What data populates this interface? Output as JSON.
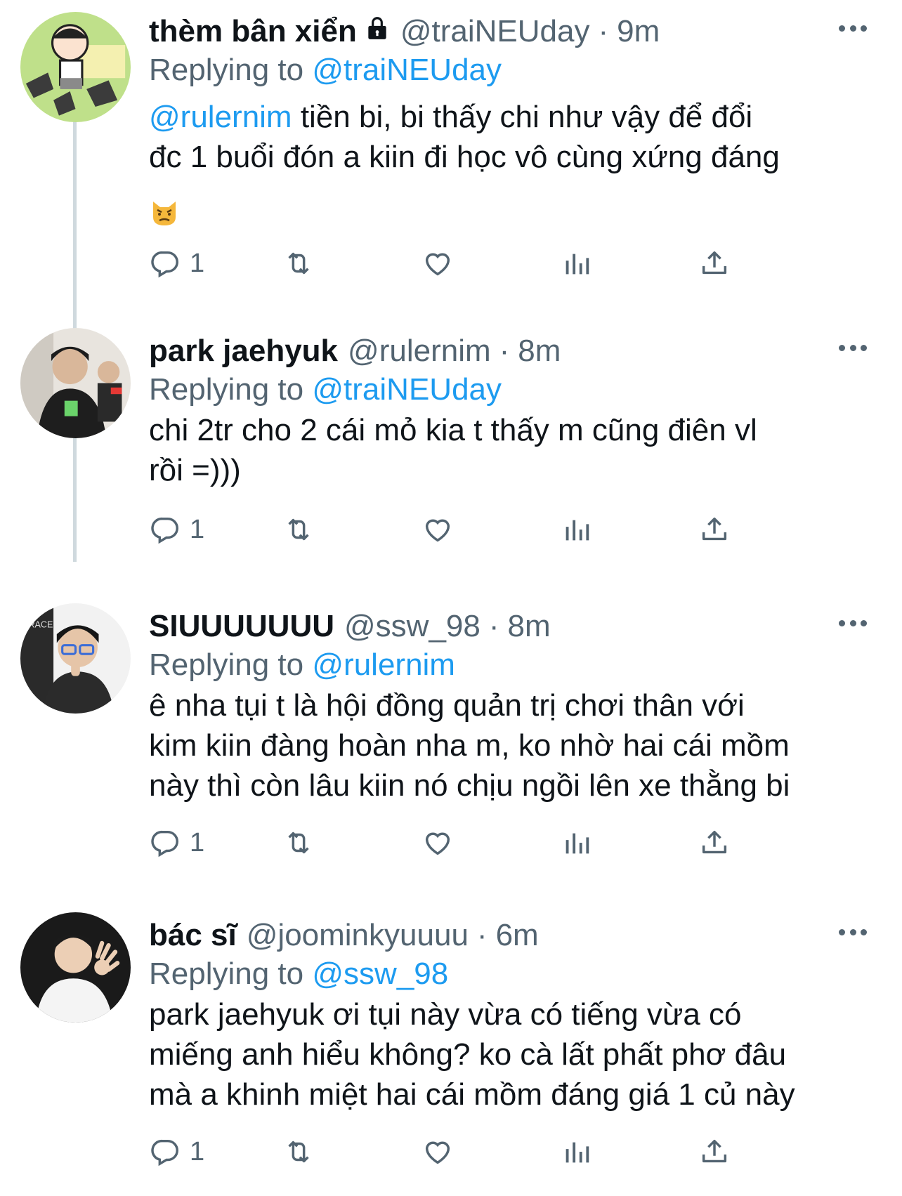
{
  "tweets": [
    {
      "name": "thèm bân xiển",
      "handle": "@traiNEUday",
      "time": "9m",
      "replying_label": "Replying to",
      "replying_to": "@traiNEUday",
      "body_mention": "@rulernim",
      "body_line1": " tiền bi, bi thấy chi như vậy để đổi",
      "body_line2": "đc 1 buổi đón a kiin đi học vô cùng xứng đáng",
      "reply_count": "1",
      "locked": true
    },
    {
      "name": "park jaehyuk",
      "handle": "@rulernim",
      "time": "8m",
      "replying_label": "Replying to",
      "replying_to": "@traiNEUday",
      "body_line1": "chi 2tr cho 2 cái mỏ kia t thấy m cũng điên vl",
      "body_line2": "rồi =)))",
      "reply_count": "1"
    },
    {
      "name": "SIUUUUUUU",
      "handle": "@ssw_98",
      "time": "8m",
      "replying_label": "Replying to",
      "replying_to": "@rulernim",
      "body_line1": "ê nha tụi t là hội đồng quản trị chơi thân với",
      "body_line2": "kim kiin đàng hoàn nha m, ko nhờ hai cái mồm",
      "body_line3": "này thì còn lâu kiin nó chịu ngồi lên xe thằng bi",
      "reply_count": "1"
    },
    {
      "name": "bác sĩ",
      "handle": "@joominkyuuuu",
      "time": "6m",
      "replying_label": "Replying to",
      "replying_to": "@ssw_98",
      "body_line1": "park jaehyuk ơi tụi này vừa có tiếng vừa có",
      "body_line2": "miếng anh hiểu không? ko cà lất phất phơ đâu",
      "body_line3": "mà a khinh miệt hai cái mồm đáng giá 1 củ này",
      "reply_count": "1"
    }
  ],
  "separator": "·",
  "icons": [
    "reply-icon",
    "retweet-icon",
    "like-icon",
    "views-icon",
    "share-icon",
    "more-icon",
    "lock-icon",
    "angry-cat-emoji"
  ],
  "colors": {
    "link": "#1d9bf0",
    "secondary": "#536471",
    "text": "#0f1419",
    "thread_line": "#cfd9de"
  }
}
